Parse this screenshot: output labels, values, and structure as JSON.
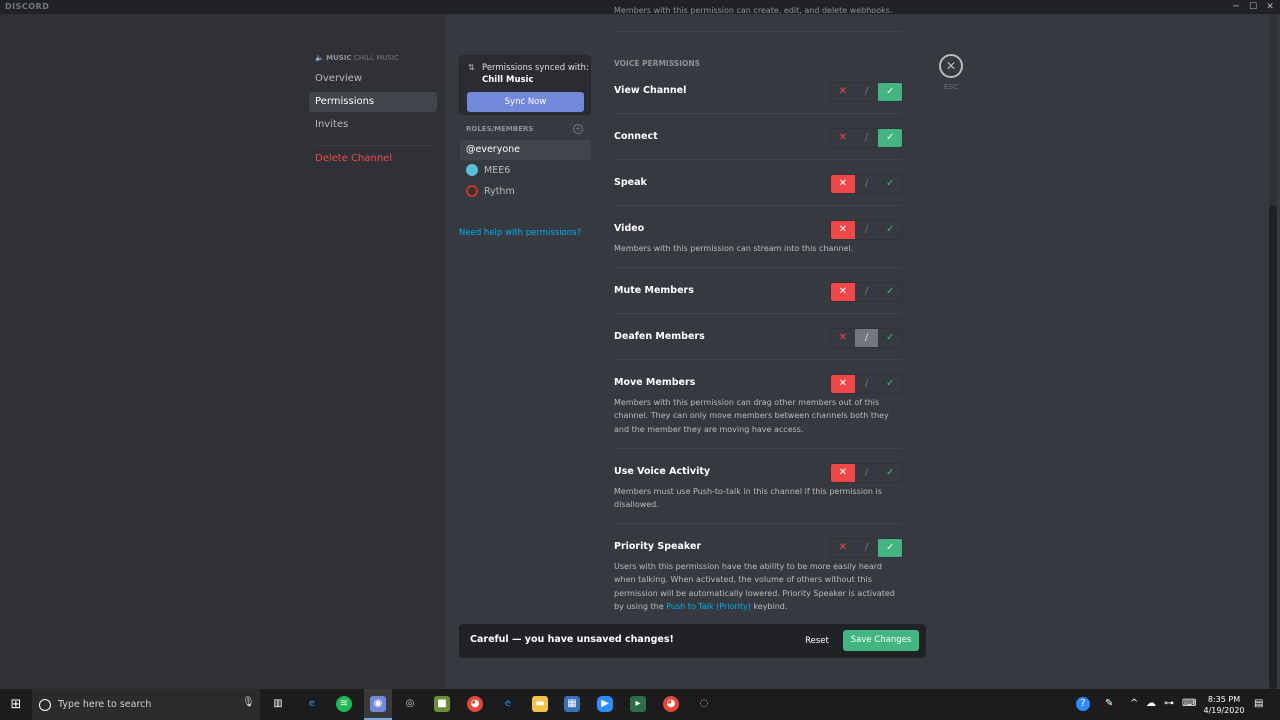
{
  "window": {
    "brand": "DISCORD",
    "min": "─",
    "max": "☐",
    "close": "✕"
  },
  "sidebar": {
    "category": "Music",
    "channel": "Chill Music",
    "items": [
      {
        "label": "Overview"
      },
      {
        "label": "Permissions"
      },
      {
        "label": "Invites"
      }
    ],
    "delete_label": "Delete Channel"
  },
  "sync": {
    "text": "Permissions synced with:",
    "name": "Chill Music",
    "button": "Sync Now"
  },
  "roles": {
    "header": "ROLES/MEMBERS",
    "plus": "+",
    "list": [
      {
        "label": "@everyone"
      },
      {
        "label": "MEE6"
      },
      {
        "label": "Rythm"
      }
    ],
    "help": "Need help with permissions?"
  },
  "permissions": {
    "top_desc": "Members with this permission can create, edit, and delete webhooks.",
    "section": "Voice Permissions",
    "items": [
      {
        "title": "View Channel",
        "desc": "",
        "state": "allow"
      },
      {
        "title": "Connect",
        "desc": "",
        "state": "allow"
      },
      {
        "title": "Speak",
        "desc": "",
        "state": "deny"
      },
      {
        "title": "Video",
        "desc": "Members with this permission can stream into this channel.",
        "state": "deny"
      },
      {
        "title": "Mute Members",
        "desc": "",
        "state": "deny"
      },
      {
        "title": "Deafen Members",
        "desc": "",
        "state": "neutral"
      },
      {
        "title": "Move Members",
        "desc": "Members with this permission can drag other members out of this channel. They can only move members between channels both they and the member they are moving have access.",
        "state": "deny"
      },
      {
        "title": "Use Voice Activity",
        "desc": "Members must use Push-to-talk in this channel if this permission is disallowed.",
        "state": "deny"
      },
      {
        "title": "Priority Speaker",
        "desc_before": "Users with this permission have the ability to be more easily heard when talking. When activated, the volume of others without this permission will be automatically lowered. Priority Speaker is activated by using the",
        "desc_link": "Push to Talk (Priority)",
        "desc_after": "keybind.",
        "state": "allow"
      }
    ],
    "glyphs": {
      "deny": "✕",
      "neutral": "/",
      "allow": "✓"
    }
  },
  "close": {
    "icon": "✕",
    "label": "ESC"
  },
  "unsaved": {
    "message": "Careful — you have unsaved changes!",
    "reset": "Reset",
    "save": "Save Changes"
  },
  "taskbar": {
    "start_icon": "⊞",
    "search_placeholder": "Type here to search",
    "mic_icon": "🎙",
    "time": "8:35 PM",
    "date": "4/19/2020"
  },
  "colors": {
    "deny": "#f04747",
    "allow": "#43b581",
    "neutral": "#72767d",
    "blurple": "#7289da",
    "link": "#00b0f4"
  }
}
